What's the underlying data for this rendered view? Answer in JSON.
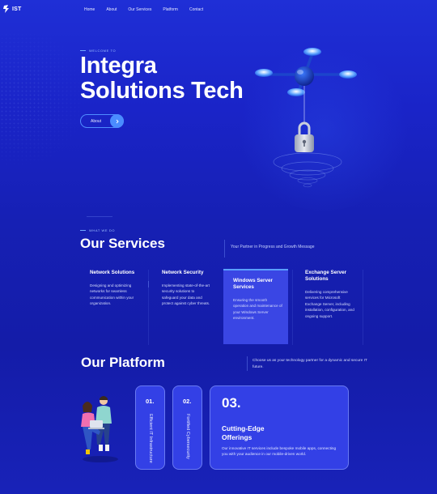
{
  "brand": {
    "logo_text": "IST"
  },
  "nav": {
    "items": [
      "Home",
      "About",
      "Our Services",
      "Platform",
      "Contact"
    ]
  },
  "hero": {
    "eyebrow": "WELCOME TO",
    "title_line1": "Integra",
    "title_line2": "Solutions Tech",
    "button_label": "About"
  },
  "services": {
    "eyebrow": "WHAT WE DO",
    "title": "Our Services",
    "tagline": "Your Partner in Progress and Growth Message",
    "items": [
      {
        "title": "Network Solutions",
        "text": "Designing and optimizing networks for seamless communication within your organization."
      },
      {
        "title": "Network Security",
        "text": "Implementing state-of-the-art security solutions to safeguard your data and protect against cyber threats."
      },
      {
        "title": "Windows Server Services",
        "text": "Ensuring the smooth operation and maintenance of your Windows Server environment."
      },
      {
        "title": "Exchange Server Solutions",
        "text": "Delivering comprehensive services for Microsoft Exchange Server, including installation, configuration, and ongoing support."
      }
    ]
  },
  "platform": {
    "title": "Our Platform",
    "description": "Choose us as your technology partner for a dynamic and secure IT future.",
    "cards": [
      {
        "num": "01.",
        "label": "Efficient IT Infrastructure"
      },
      {
        "num": "02.",
        "label": "Fortified Cybersecurity"
      },
      {
        "num": "03.",
        "title_line1": "Cutting-Edge",
        "title_line2": "Offerings",
        "text": "Our innovative IT services include bespoke mobile apps, connecting you with your audience in our mobile-driven world."
      }
    ]
  },
  "colors": {
    "accent": "#4a8cff",
    "background": "#1a23c6",
    "card": "#3340e6"
  }
}
